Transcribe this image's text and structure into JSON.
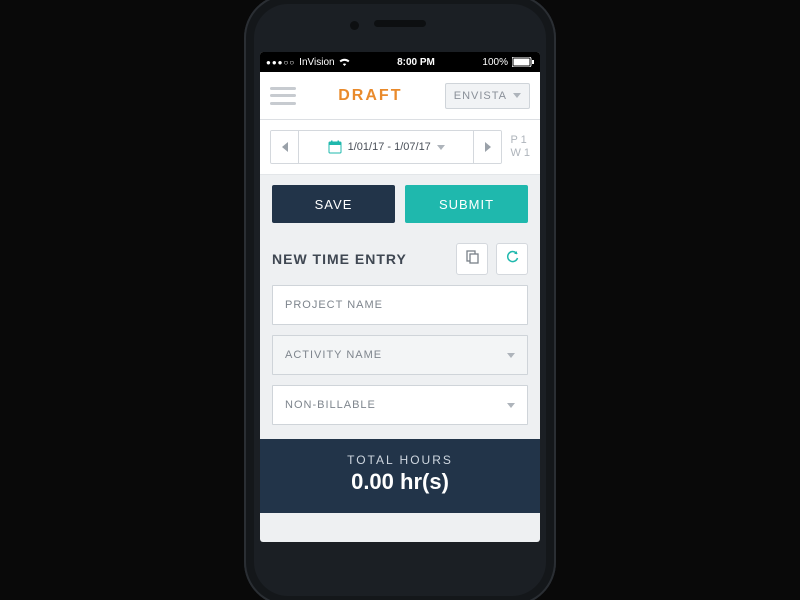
{
  "statusbar": {
    "carrier": "InVision",
    "time": "8:00 PM",
    "battery": "100%"
  },
  "header": {
    "title": "DRAFT",
    "company": "ENVISTA"
  },
  "date": {
    "range": "1/01/17 - 1/07/17",
    "period": "P 1",
    "week": "W 1"
  },
  "actions": {
    "save": "SAVE",
    "submit": "SUBMIT"
  },
  "section": {
    "title": "NEW TIME ENTRY"
  },
  "fields": {
    "project_placeholder": "PROJECT NAME",
    "activity_placeholder": "ACTIVITY NAME",
    "billable_value": "NON-BILLABLE"
  },
  "totals": {
    "label": "TOTAL HOURS",
    "value": "0.00 hr(s)"
  },
  "colors": {
    "accent_orange": "#e98a2b",
    "accent_teal": "#1fb8ad",
    "navy": "#223449"
  }
}
